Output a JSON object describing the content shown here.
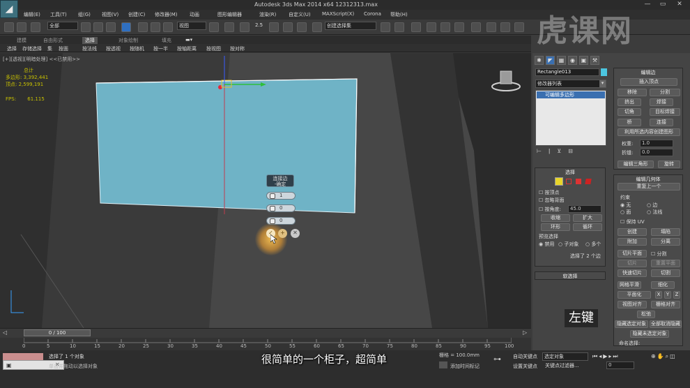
{
  "window": {
    "title": "Autodesk 3ds Max  2014 x64      12312313.max",
    "app_icon": "3ds-max-icon",
    "minimize": "—",
    "maximize": "▭",
    "close": "✕"
  },
  "menu": [
    "编辑(E)",
    "工具(T)",
    "组(G)",
    "视图(V)",
    "创建(C)",
    "修改器(M)",
    "动画",
    "图形编辑器",
    "渲染(R)",
    "自定义(U)",
    "MAXScript(X)",
    "Corona",
    "帮助(H)"
  ],
  "toolbar": {
    "selection_filter": "全部",
    "reference_coord": "视图",
    "named_selection": "创建选择集",
    "angle_snap": "2.5"
  },
  "ribbon": {
    "tabs": [
      "建模",
      "自由形式",
      "选择",
      "对象绘制",
      "填充"
    ],
    "active_tab": "选择",
    "buttons": [
      "选择",
      "存储选择",
      "集",
      "按面",
      "按法线",
      "按透视",
      "按随机",
      "按一半",
      "按轴距离",
      "按视图",
      "按对称"
    ]
  },
  "viewport": {
    "label": "[+][透视][明暗处理] <<已禁用>>",
    "stats_total": "总计",
    "stats_poly_label": "多边形:",
    "stats_poly": "3,392,441",
    "stats_vert_label": "顶点:",
    "stats_vert": "2,599,191",
    "fps_label": "FPS:",
    "fps": "61.115",
    "caddy_title": "连接边",
    "caddy_subtitle": "-确定",
    "spin_segments": "1",
    "spin_pinch": "0",
    "spin_slide": "0",
    "box_color": "#6fb3c6"
  },
  "command_panel": {
    "object_name": "Rectangle013",
    "modifier_list": "修改器列表",
    "stack_item": "可编辑多边形",
    "selection": {
      "title": "选择",
      "by_vertex": "按顶点",
      "ignore_backfacing": "忽略背面",
      "by_angle": "按角度:",
      "angle": "45.0",
      "shrink": "收缩",
      "grow": "扩大",
      "ring": "环形",
      "loop": "循环",
      "preview_title": "预览选择",
      "preview_disabled": "禁用",
      "preview_subobj": "子对象",
      "preview_multi": "多个",
      "status": "选择了 2 个边"
    },
    "soft_selection": "软选择",
    "edit_edges": {
      "title": "编辑边",
      "insert_vertex": "插入顶点",
      "remove": "移除",
      "split": "分割",
      "extrude": "挤出",
      "weld": "焊接",
      "chamfer": "切角",
      "target_weld": "目标焊接",
      "bridge": "桥",
      "connect": "连接",
      "create_shape": "利用所选内容创建图形",
      "weight_label": "权重:",
      "weight": "1.0",
      "crease_label": "折缝:",
      "crease": "0.0",
      "edit_tri": "编辑三角形",
      "turn": "旋转"
    },
    "edit_geometry": {
      "title": "编辑几何体",
      "repeat_last": "重复上一个",
      "constraints": "约束",
      "c_none": "无",
      "c_edge": "边",
      "c_face": "面",
      "c_normal": "法线",
      "preserve_uv": "保持 UV",
      "create": "创建",
      "collapse": "塌陷",
      "attach": "附加",
      "detach": "分离",
      "slice_plane": "切片平面",
      "split": "分割",
      "slice": "切片",
      "reset_plane": "重置平面",
      "quickslice": "快速切片",
      "cut": "切割",
      "meshsmooth": "网格平滑",
      "tessellate": "细化",
      "make_planar": "平面化",
      "x": "X",
      "y": "Y",
      "z": "Z",
      "view_align": "视图对齐",
      "grid_align": "栅格对齐",
      "relax": "松弛",
      "hide_selected": "隐藏选定对象",
      "unhide_all": "全部取消隐藏",
      "hide_unselected": "隐藏未选定对象",
      "named_sel": "命名选择:"
    }
  },
  "timeline": {
    "slider": "0 / 100",
    "ticks": [
      "0",
      "5",
      "10",
      "15",
      "20",
      "25",
      "30",
      "35",
      "40",
      "45",
      "50",
      "55",
      "60",
      "65",
      "70",
      "75",
      "80",
      "85",
      "90",
      "95",
      "100"
    ]
  },
  "status": {
    "line1": "选择了 1 个对象",
    "line2": "单击并拖动以选择对象",
    "grid": "栅格 = 100.0mm",
    "auto_key": "自动关键点",
    "set_key": "设置关键点",
    "selected_obj": "选定对象",
    "key_filter": "关键点过滤器...",
    "add_time_tag": "添加时间标记",
    "frame": "0"
  },
  "overlay": {
    "subtitle": "很简单的一个柜子，超简单",
    "watermark": "虎课网",
    "left_click": "左键"
  }
}
